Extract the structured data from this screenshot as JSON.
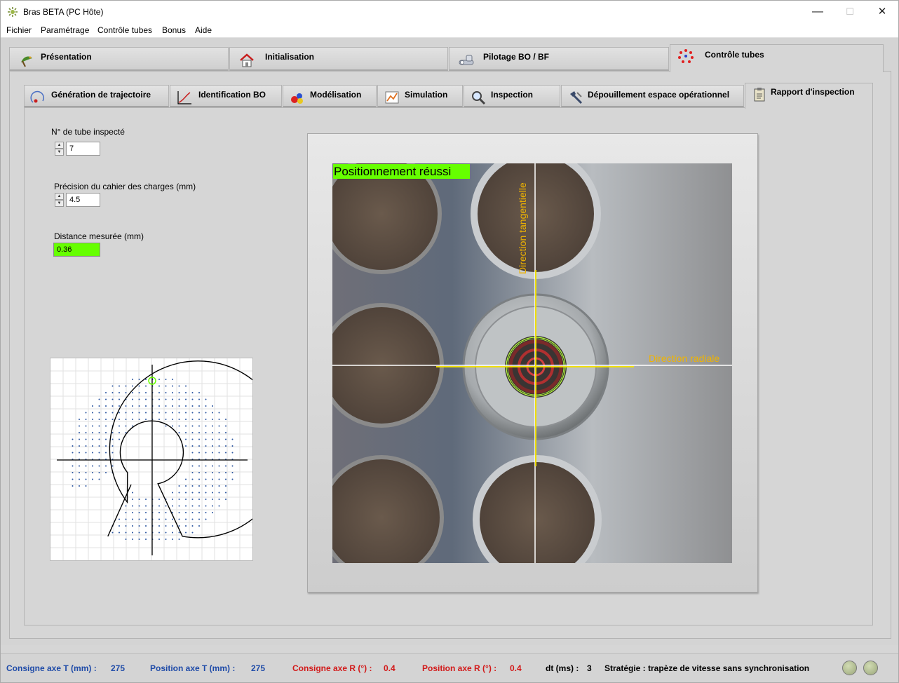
{
  "window": {
    "title": "Bras BETA (PC Hôte)",
    "minimize": "—",
    "maximize": "☐",
    "close": "✕"
  },
  "menu": [
    "Fichier",
    "Paramétrage",
    "Contrôle tubes",
    "Bonus",
    "Aide"
  ],
  "main_tabs": [
    {
      "label": "Présentation",
      "icon": "bird-icon",
      "active": false
    },
    {
      "label": "Initialisation",
      "icon": "home-icon",
      "active": false
    },
    {
      "label": "Pilotage BO / BF",
      "icon": "robot-arm-icon",
      "active": false
    },
    {
      "label": "Contrôle tubes",
      "icon": "tube-circle-icon",
      "active": true
    }
  ],
  "sub_tabs": [
    {
      "label": "Génération de trajectoire",
      "icon": "trajectory-icon",
      "active": false
    },
    {
      "label": "Identification BO",
      "icon": "curve-icon",
      "active": false
    },
    {
      "label": "Modélisation",
      "icon": "shapes-icon",
      "active": false
    },
    {
      "label": "Simulation",
      "icon": "simulation-icon",
      "active": false
    },
    {
      "label": "Inspection",
      "icon": "magnifier-icon",
      "active": false
    },
    {
      "label": "Dépouillement espace opérationnel",
      "icon": "tools-icon",
      "active": false
    },
    {
      "label": "Rapport d'inspection",
      "icon": "clipboard-icon",
      "active": true
    }
  ],
  "controls": {
    "tube_number": {
      "label": "N° de tube inspecté",
      "value": "7"
    },
    "precision": {
      "label": "Précision du cahier des charges (mm)",
      "value": "4.5"
    },
    "distance": {
      "label": "Distance mesurée (mm)",
      "value": "0.36",
      "status_color": "#66ff00"
    }
  },
  "image": {
    "status_text": "Positionnement réussi",
    "tangential_label": "Direction tangentielle",
    "radial_label": "Direction radiale",
    "label_color": "#f0b400",
    "target_color": "#b4ff3c"
  },
  "status_bar": {
    "consigne_t": {
      "label": "Consigne axe T (mm) :",
      "value": "275"
    },
    "position_t": {
      "label": "Position axe T (mm) :",
      "value": "275"
    },
    "consigne_r": {
      "label": "Consigne axe R (°) :",
      "value": "0.4"
    },
    "position_r": {
      "label": "Position axe R (°) :",
      "value": "0.4"
    },
    "dt": {
      "label": "dt (ms) :",
      "value": "3"
    },
    "strategie": "Stratégie : trapèze de vitesse sans synchronisation",
    "accent_blue": "#1f4ba8",
    "accent_red": "#d21919"
  }
}
